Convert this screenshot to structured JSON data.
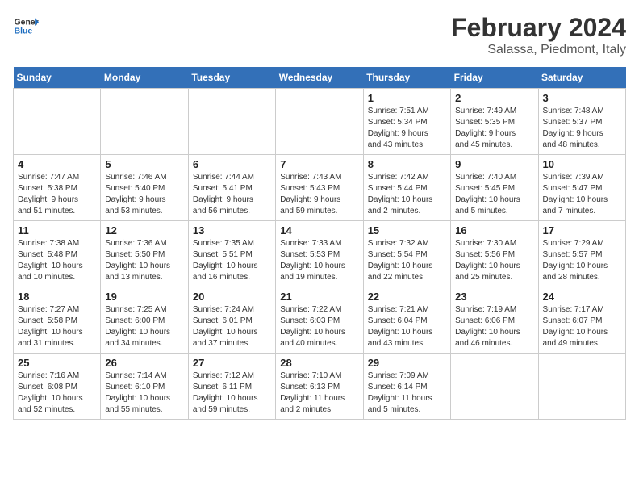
{
  "header": {
    "logo_text_general": "General",
    "logo_text_blue": "Blue",
    "month_year": "February 2024",
    "location": "Salassa, Piedmont, Italy"
  },
  "calendar": {
    "days_of_week": [
      "Sunday",
      "Monday",
      "Tuesday",
      "Wednesday",
      "Thursday",
      "Friday",
      "Saturday"
    ],
    "weeks": [
      [
        {
          "day": "",
          "info": ""
        },
        {
          "day": "",
          "info": ""
        },
        {
          "day": "",
          "info": ""
        },
        {
          "day": "",
          "info": ""
        },
        {
          "day": "1",
          "info": "Sunrise: 7:51 AM\nSunset: 5:34 PM\nDaylight: 9 hours\nand 43 minutes."
        },
        {
          "day": "2",
          "info": "Sunrise: 7:49 AM\nSunset: 5:35 PM\nDaylight: 9 hours\nand 45 minutes."
        },
        {
          "day": "3",
          "info": "Sunrise: 7:48 AM\nSunset: 5:37 PM\nDaylight: 9 hours\nand 48 minutes."
        }
      ],
      [
        {
          "day": "4",
          "info": "Sunrise: 7:47 AM\nSunset: 5:38 PM\nDaylight: 9 hours\nand 51 minutes."
        },
        {
          "day": "5",
          "info": "Sunrise: 7:46 AM\nSunset: 5:40 PM\nDaylight: 9 hours\nand 53 minutes."
        },
        {
          "day": "6",
          "info": "Sunrise: 7:44 AM\nSunset: 5:41 PM\nDaylight: 9 hours\nand 56 minutes."
        },
        {
          "day": "7",
          "info": "Sunrise: 7:43 AM\nSunset: 5:43 PM\nDaylight: 9 hours\nand 59 minutes."
        },
        {
          "day": "8",
          "info": "Sunrise: 7:42 AM\nSunset: 5:44 PM\nDaylight: 10 hours\nand 2 minutes."
        },
        {
          "day": "9",
          "info": "Sunrise: 7:40 AM\nSunset: 5:45 PM\nDaylight: 10 hours\nand 5 minutes."
        },
        {
          "day": "10",
          "info": "Sunrise: 7:39 AM\nSunset: 5:47 PM\nDaylight: 10 hours\nand 7 minutes."
        }
      ],
      [
        {
          "day": "11",
          "info": "Sunrise: 7:38 AM\nSunset: 5:48 PM\nDaylight: 10 hours\nand 10 minutes."
        },
        {
          "day": "12",
          "info": "Sunrise: 7:36 AM\nSunset: 5:50 PM\nDaylight: 10 hours\nand 13 minutes."
        },
        {
          "day": "13",
          "info": "Sunrise: 7:35 AM\nSunset: 5:51 PM\nDaylight: 10 hours\nand 16 minutes."
        },
        {
          "day": "14",
          "info": "Sunrise: 7:33 AM\nSunset: 5:53 PM\nDaylight: 10 hours\nand 19 minutes."
        },
        {
          "day": "15",
          "info": "Sunrise: 7:32 AM\nSunset: 5:54 PM\nDaylight: 10 hours\nand 22 minutes."
        },
        {
          "day": "16",
          "info": "Sunrise: 7:30 AM\nSunset: 5:56 PM\nDaylight: 10 hours\nand 25 minutes."
        },
        {
          "day": "17",
          "info": "Sunrise: 7:29 AM\nSunset: 5:57 PM\nDaylight: 10 hours\nand 28 minutes."
        }
      ],
      [
        {
          "day": "18",
          "info": "Sunrise: 7:27 AM\nSunset: 5:58 PM\nDaylight: 10 hours\nand 31 minutes."
        },
        {
          "day": "19",
          "info": "Sunrise: 7:25 AM\nSunset: 6:00 PM\nDaylight: 10 hours\nand 34 minutes."
        },
        {
          "day": "20",
          "info": "Sunrise: 7:24 AM\nSunset: 6:01 PM\nDaylight: 10 hours\nand 37 minutes."
        },
        {
          "day": "21",
          "info": "Sunrise: 7:22 AM\nSunset: 6:03 PM\nDaylight: 10 hours\nand 40 minutes."
        },
        {
          "day": "22",
          "info": "Sunrise: 7:21 AM\nSunset: 6:04 PM\nDaylight: 10 hours\nand 43 minutes."
        },
        {
          "day": "23",
          "info": "Sunrise: 7:19 AM\nSunset: 6:06 PM\nDaylight: 10 hours\nand 46 minutes."
        },
        {
          "day": "24",
          "info": "Sunrise: 7:17 AM\nSunset: 6:07 PM\nDaylight: 10 hours\nand 49 minutes."
        }
      ],
      [
        {
          "day": "25",
          "info": "Sunrise: 7:16 AM\nSunset: 6:08 PM\nDaylight: 10 hours\nand 52 minutes."
        },
        {
          "day": "26",
          "info": "Sunrise: 7:14 AM\nSunset: 6:10 PM\nDaylight: 10 hours\nand 55 minutes."
        },
        {
          "day": "27",
          "info": "Sunrise: 7:12 AM\nSunset: 6:11 PM\nDaylight: 10 hours\nand 59 minutes."
        },
        {
          "day": "28",
          "info": "Sunrise: 7:10 AM\nSunset: 6:13 PM\nDaylight: 11 hours\nand 2 minutes."
        },
        {
          "day": "29",
          "info": "Sunrise: 7:09 AM\nSunset: 6:14 PM\nDaylight: 11 hours\nand 5 minutes."
        },
        {
          "day": "",
          "info": ""
        },
        {
          "day": "",
          "info": ""
        }
      ]
    ]
  }
}
